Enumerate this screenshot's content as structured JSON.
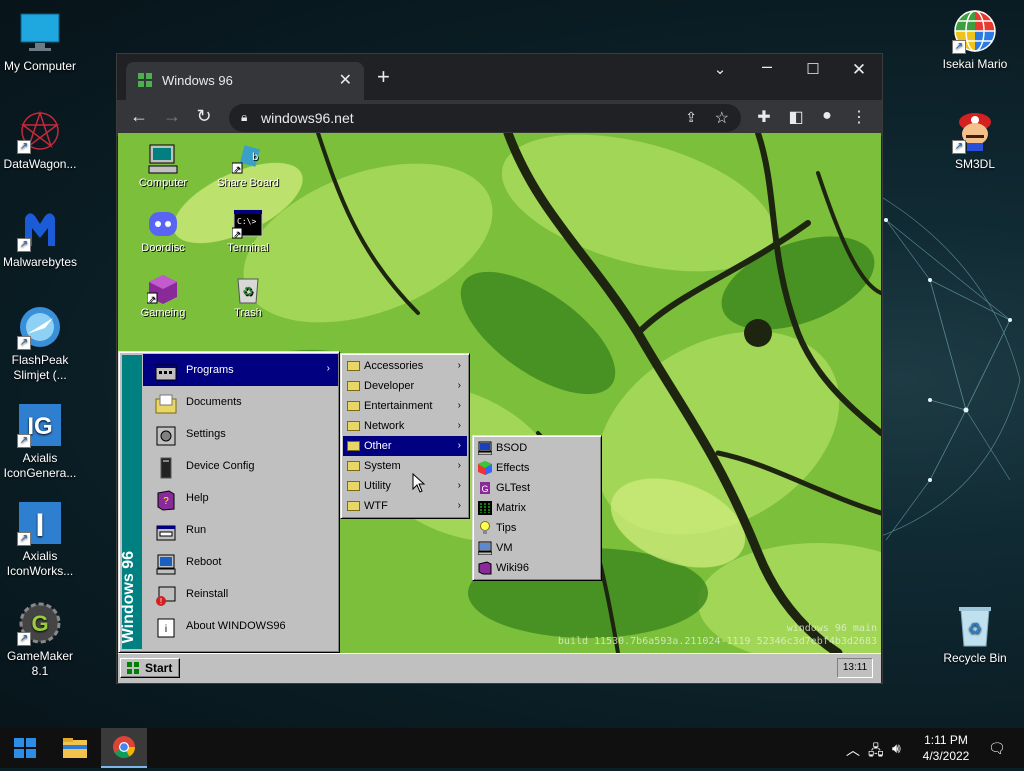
{
  "desktop": {
    "left_icons": [
      {
        "label": "My Computer",
        "icon": "monitor-icon"
      },
      {
        "label": "DataWagon...",
        "icon": "datawagon-icon"
      },
      {
        "label": "Malwarebytes",
        "icon": "malwarebytes-icon"
      },
      {
        "label": "FlashPeak Slimjet (...",
        "icon": "slimjet-icon"
      },
      {
        "label": "Axialis IconGenera...",
        "icon": "axialis-ig-icon"
      },
      {
        "label": "Axialis IconWorks...",
        "icon": "axialis-iw-icon"
      },
      {
        "label": "GameMaker 8.1",
        "icon": "gamemaker-icon"
      }
    ],
    "right_icons": [
      {
        "label": "Isekai Mario",
        "icon": "globe-icon"
      },
      {
        "label": "SM3DL",
        "icon": "mario-icon"
      },
      {
        "label": "Recycle Bin",
        "icon": "recycle-bin-icon"
      }
    ]
  },
  "browser": {
    "tab_title": "Windows 96",
    "url": "windows96.net",
    "new_tab": "+",
    "close_tab": "✕"
  },
  "w96": {
    "desktop_icons": [
      {
        "label": "Computer"
      },
      {
        "label": "Share Board"
      },
      {
        "label": "Doordisc"
      },
      {
        "label": "Terminal"
      },
      {
        "label": "Gameing"
      },
      {
        "label": "Trash"
      }
    ],
    "watermark_line1": "windows 96 main",
    "watermark_line2": "build 11530.7b6a593a.211024-1119 52346c3d7ebf4b3d2683",
    "start_label": "Start",
    "clock": "13:11",
    "banner": "Windows 96",
    "start_menu": [
      {
        "label": "Programs"
      },
      {
        "label": "Documents"
      },
      {
        "label": "Settings"
      },
      {
        "label": "Device Config"
      },
      {
        "label": "Help"
      },
      {
        "label": "Run"
      },
      {
        "label": "Reboot"
      },
      {
        "label": "Reinstall"
      },
      {
        "label": "About WINDOWS96"
      }
    ],
    "programs_menu": [
      {
        "label": "Accessories"
      },
      {
        "label": "Developer"
      },
      {
        "label": "Entertainment"
      },
      {
        "label": "Network"
      },
      {
        "label": "Other"
      },
      {
        "label": "System"
      },
      {
        "label": "Utility"
      },
      {
        "label": "WTF"
      }
    ],
    "other_menu": [
      {
        "label": "BSOD"
      },
      {
        "label": "Effects"
      },
      {
        "label": "GLTest"
      },
      {
        "label": "Matrix"
      },
      {
        "label": "Tips"
      },
      {
        "label": "VM"
      },
      {
        "label": "Wiki96"
      }
    ]
  },
  "taskbar": {
    "time": "1:11 PM",
    "date": "4/3/2022"
  },
  "colors": {
    "w96_highlight": "#000080",
    "w96_face": "#c0c0c0",
    "w96_banner": "#008080",
    "chrome_dark": "#202124"
  }
}
